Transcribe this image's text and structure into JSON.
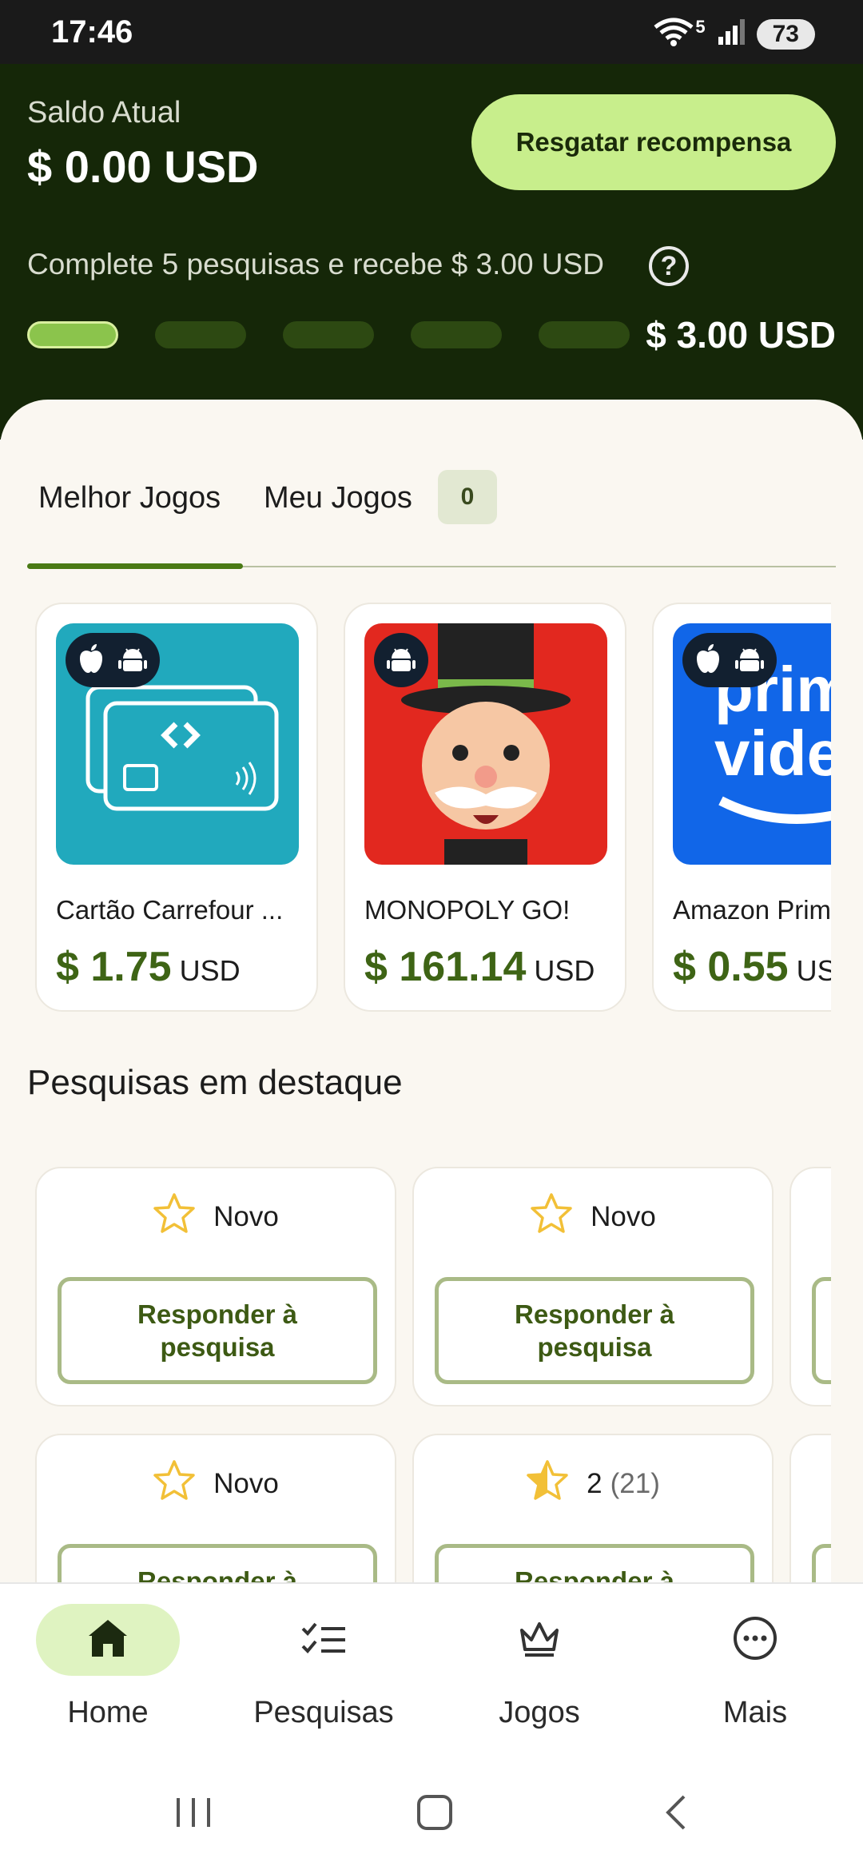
{
  "status_bar": {
    "time": "17:46",
    "battery": "73",
    "network": "5"
  },
  "header": {
    "balance_label": "Saldo Atual",
    "balance_value": "$ 0.00 USD",
    "redeem_label": "Resgatar recompensa",
    "progress_text": "Complete 5 pesquisas e recebe $ 3.00 USD",
    "progress_reward": "$ 3.00 USD",
    "progress_completed": 1,
    "progress_total": 5
  },
  "tabs": {
    "best": "Melhor Jogos",
    "mine": "Meu Jogos",
    "mine_count": "0"
  },
  "games": [
    {
      "name": "Cartão Carrefour ...",
      "amount": "$ 1.75",
      "unit": "USD",
      "platforms": [
        "apple-icon",
        "android-icon"
      ]
    },
    {
      "name": "MONOPOLY GO!",
      "amount": "$ 161.14",
      "unit": "USD",
      "platforms": [
        "android-icon"
      ]
    },
    {
      "name": "Amazon Prim",
      "amount": "$ 0.55",
      "unit": "US",
      "platforms": [
        "apple-icon",
        "android-icon"
      ]
    }
  ],
  "featured": {
    "title": "Pesquisas em destaque",
    "surveys": [
      {
        "rating": "Novo",
        "count": "",
        "button": "Responder à pesquisa"
      },
      {
        "rating": "Novo",
        "count": "",
        "button": "Responder à pesquisa"
      },
      {
        "rating": "Novo",
        "count": "",
        "button": "Responder à pesquisa"
      },
      {
        "rating": "2",
        "count": "(21)",
        "button": "Responder à pesquisa"
      }
    ]
  },
  "bottom_nav": {
    "home": "Home",
    "surveys": "Pesquisas",
    "games": "Jogos",
    "more": "Mais"
  },
  "colors": {
    "header_bg": "#152708",
    "accent_button": "#c8ee8c",
    "price_green": "#3e6415",
    "tab_indicator": "#4a7a15"
  }
}
